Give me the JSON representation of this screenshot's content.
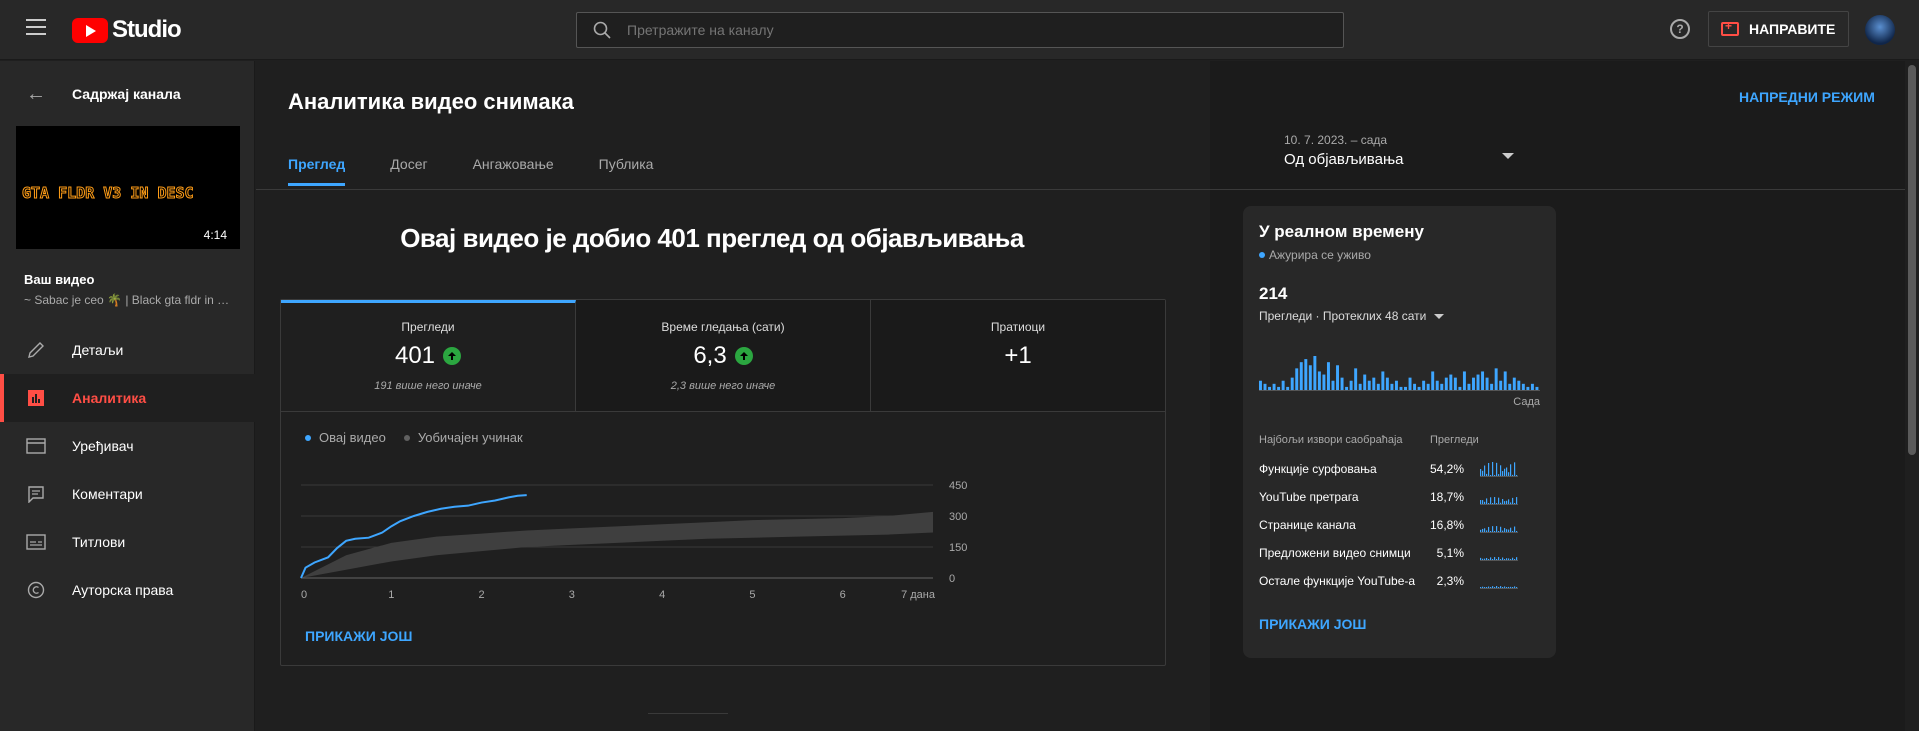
{
  "header": {
    "logo_text": "Studio",
    "search_placeholder": "Претражите на каналу",
    "help_label": "?",
    "create_label": "НАПРАВИТЕ"
  },
  "sidebar": {
    "back_label": "Садржај канала",
    "thumbnail_text": "GTA FLDR V3  IN DESC",
    "thumbnail_duration": "4:14",
    "your_video_label": "Ваш видео",
    "video_title": "~ Sabac je ceo 🌴 | Black gta fldr in desc",
    "items": [
      {
        "label": "Детаљи",
        "icon": "pencil-icon"
      },
      {
        "label": "Аналитика",
        "icon": "analytics-icon"
      },
      {
        "label": "Уређивач",
        "icon": "film-icon"
      },
      {
        "label": "Коментари",
        "icon": "comment-icon"
      },
      {
        "label": "Титлови",
        "icon": "subtitles-icon"
      },
      {
        "label": "Ауторска права",
        "icon": "copyright-icon"
      }
    ],
    "active_index": 1
  },
  "main": {
    "title": "Аналитика видео снимака",
    "advanced_label": "НАПРЕДНИ РЕЖИМ",
    "tabs": [
      "Преглед",
      "Досег",
      "Ангажовање",
      "Публика"
    ],
    "date_range": "10. 7. 2023. – сада",
    "date_label": "Од објављивања",
    "headline": "Овај видео је добио 401 преглед од објављивања",
    "metrics": [
      {
        "label": "Прегледи",
        "value": "401",
        "note": "191 више него иначе",
        "trend_up": true
      },
      {
        "label": "Време гледања (сати)",
        "value": "6,3",
        "note": "2,3 више него иначе",
        "trend_up": true
      },
      {
        "label": "Пратиоци",
        "value": "+1",
        "note": "",
        "trend_up": false
      }
    ],
    "legend": [
      {
        "label": "Овај видео",
        "color": "#3ea6ff"
      },
      {
        "label": "Уобичајен учинак",
        "color": "#606060"
      }
    ],
    "show_more": "ПРИКАЖИ ЈОШ"
  },
  "chart_data": {
    "type": "line",
    "x_tick_labels": [
      "0",
      "1",
      "2",
      "3",
      "4",
      "5",
      "6",
      "7 дана"
    ],
    "y_tick_labels": [
      "0",
      "150",
      "300",
      "450"
    ],
    "xlim": [
      0,
      7
    ],
    "ylim": [
      0,
      450
    ],
    "grid": true,
    "series": [
      {
        "name": "Овај видео",
        "color": "#3ea6ff",
        "x": [
          0,
          0.05,
          0.15,
          0.3,
          0.4,
          0.5,
          0.6,
          0.75,
          0.9,
          1.0,
          1.1,
          1.25,
          1.4,
          1.55,
          1.7,
          1.85,
          2.0,
          2.15,
          2.3,
          2.4,
          2.5
        ],
        "y": [
          0,
          50,
          75,
          100,
          145,
          180,
          190,
          195,
          220,
          250,
          275,
          300,
          320,
          335,
          345,
          350,
          365,
          375,
          390,
          398,
          401
        ]
      }
    ],
    "typical_band": {
      "name": "Уобичајен учинак",
      "color": "#3f3f3f",
      "x": [
        0,
        0.5,
        1,
        1.5,
        2,
        2.5,
        3,
        3.5,
        4,
        4.5,
        5,
        5.5,
        6,
        6.5,
        7
      ],
      "low": [
        0,
        40,
        80,
        110,
        130,
        150,
        160,
        170,
        180,
        190,
        195,
        200,
        205,
        210,
        220
      ],
      "high": [
        0,
        110,
        170,
        200,
        215,
        230,
        240,
        250,
        260,
        270,
        280,
        285,
        290,
        300,
        320
      ]
    }
  },
  "realtime": {
    "title": "У реалном времену",
    "subtitle": "Ажурира се уживо",
    "value": "214",
    "metric_label": "Прегледи · Протеклих 48 сати",
    "now_label": "Сада",
    "bars": [
      3,
      2,
      1,
      2,
      1,
      3,
      1,
      4,
      7,
      9,
      10,
      8,
      11,
      6,
      5,
      9,
      3,
      8,
      4,
      1,
      3,
      7,
      2,
      5,
      3,
      4,
      2,
      6,
      4,
      2,
      3,
      1,
      1,
      4,
      2,
      1,
      3,
      2,
      6,
      3,
      2,
      4,
      5,
      4,
      1,
      6,
      2,
      4,
      5,
      6,
      4,
      2,
      7,
      3,
      6,
      2,
      4,
      3,
      2,
      1,
      2,
      1
    ],
    "sources_header": "Најбољи извори саобраћаја",
    "sources_value_header": "Прегледи",
    "sources": [
      {
        "name": "Функције сурфовања",
        "pct": "54,2%"
      },
      {
        "name": "YouTube претрага",
        "pct": "18,7%"
      },
      {
        "name": "Странице канала",
        "pct": "16,8%"
      },
      {
        "name": "Предложени видео снимци",
        "pct": "5,1%"
      },
      {
        "name": "Остале функције YouTube-а",
        "pct": "2,3%"
      }
    ],
    "more_label": "ПРИКАЖИ ЈОШ"
  }
}
